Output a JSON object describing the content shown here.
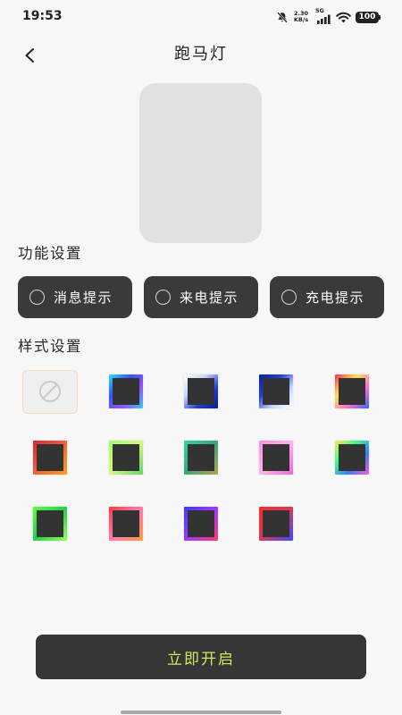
{
  "status_bar": {
    "time": "19:53",
    "net_speed_value": "2.30",
    "net_speed_unit": "KB/s",
    "network_type": "5G",
    "battery_level": "100",
    "icons": {
      "mute": "mute-bell-icon",
      "signal": "signal-bars-icon",
      "wifi": "wifi-icon",
      "battery": "battery-icon"
    }
  },
  "header": {
    "title": "跑马灯",
    "back_icon": "chevron-left-icon"
  },
  "function_section": {
    "label": "功能设置",
    "options": [
      {
        "label": "消息提示",
        "selected": false
      },
      {
        "label": "来电提示",
        "selected": false
      },
      {
        "label": "充电提示",
        "selected": false
      }
    ]
  },
  "style_section": {
    "label": "样式设置",
    "swatches": [
      {
        "icon": "prohibited-icon",
        "selected": true
      },
      {
        "colors": [
          "#29e3f5",
          "#3457ff",
          "#9b4dff",
          "#2ad0ff"
        ]
      },
      {
        "colors": [
          "#ffffff",
          "#c9d6ff",
          "#1f3fd6",
          "#0b1f8f"
        ]
      },
      {
        "colors": [
          "#0b1f8f",
          "#1f3fd6",
          "#c9d6ff",
          "#ffffff"
        ]
      },
      {
        "colors": [
          "#ff2a5f",
          "#ffe14d",
          "#ff6ad5",
          "#2a6bff"
        ]
      },
      {
        "colors": [
          "#d7263d",
          "#f46036",
          "#ff9f1c"
        ]
      },
      {
        "colors": [
          "#9cff6b",
          "#d4f77a",
          "#5ed66a"
        ]
      },
      {
        "colors": [
          "#2fd4a8",
          "#3aa67a",
          "#b9a24a"
        ]
      },
      {
        "colors": [
          "#ff8fe0",
          "#ffb3ec",
          "#e56bd6"
        ]
      },
      {
        "colors": [
          "#ffe84d",
          "#3cff8a",
          "#3a7bff",
          "#ff5ad6"
        ]
      },
      {
        "colors": [
          "#5cff3a",
          "#1fd14a",
          "#9bff4d"
        ]
      },
      {
        "colors": [
          "#ff3a3a",
          "#ff7ab6",
          "#ff9a3a"
        ]
      },
      {
        "colors": [
          "#3a3aff",
          "#9b3aff",
          "#ff3a6b"
        ]
      },
      {
        "colors": [
          "#ff2a2a",
          "#d13a5a",
          "#3a4bff"
        ]
      }
    ]
  },
  "start_button": {
    "label": "立即开启"
  },
  "colors": {
    "page_bg": "#f7f7f7",
    "preview_bg": "#e1e1e1",
    "dark_button_bg": "#3a3a3a",
    "start_button_bg": "#363636",
    "start_button_text": "#d6e35c",
    "swatch_fill": "#333333",
    "none_border": "#f3dcc0",
    "none_bg": "#efefef"
  }
}
